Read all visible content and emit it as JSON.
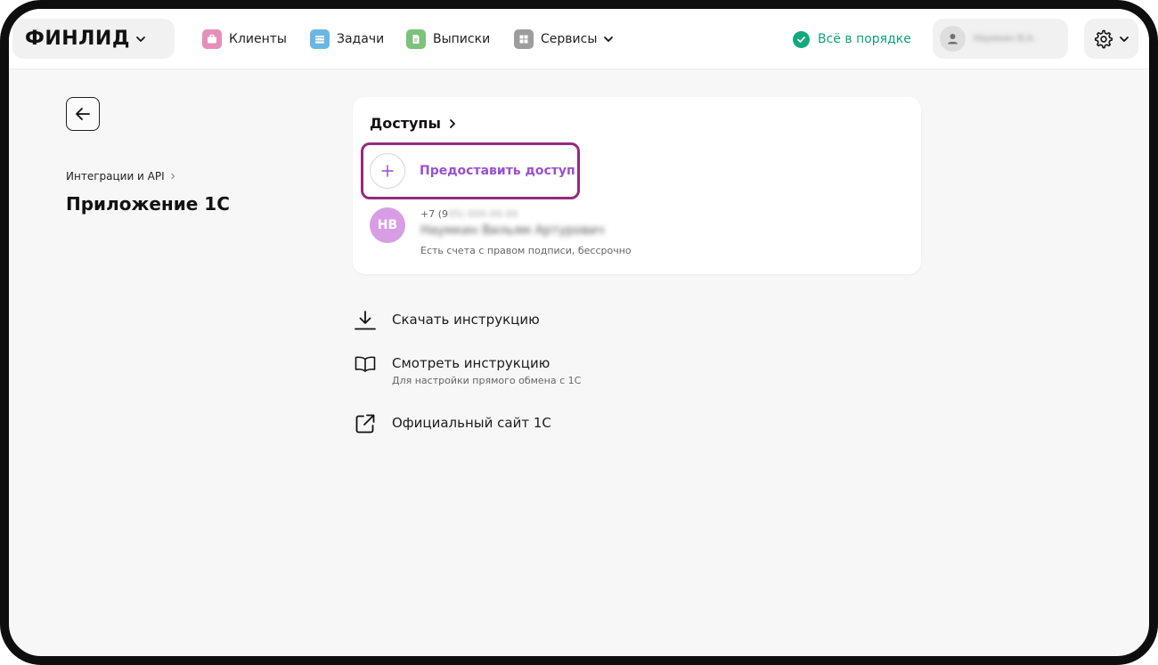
{
  "header": {
    "brand": "ФИНЛИД",
    "nav": [
      {
        "label": "Клиенты",
        "icon": "briefcase-icon",
        "color": "#e68fb8"
      },
      {
        "label": "Задачи",
        "icon": "stack-icon",
        "color": "#6ab7e3"
      },
      {
        "label": "Выписки",
        "icon": "document-icon",
        "color": "#7cc27a"
      },
      {
        "label": "Сервисы",
        "icon": "grid-icon",
        "color": "#9d9d9d"
      }
    ],
    "status": "Всё в порядке",
    "user_name": "Наумкин В.А."
  },
  "left": {
    "breadcrumb": "Интеграции и API",
    "title": "Приложение 1С"
  },
  "card": {
    "title": "Доступы",
    "grant_label": "Предоставить доступ",
    "access": {
      "initials": "НВ",
      "phone_prefix": "+7 (9",
      "phone_rest": "05) 000-00-00",
      "name": "Наумкин Вильям Артурович",
      "description": "Есть счета с правом подписи, бессрочно"
    }
  },
  "links": [
    {
      "label": "Скачать инструкцию",
      "icon": "download-icon",
      "subtitle": ""
    },
    {
      "label": "Смотреть инструкцию",
      "icon": "book-icon",
      "subtitle": "Для настройки прямого обмена с 1С"
    },
    {
      "label": "Официальный сайт 1С",
      "icon": "external-link-icon",
      "subtitle": ""
    }
  ],
  "colors": {
    "accent": "#9a4fd0",
    "highlight_border": "#942b7e",
    "success": "#0fa37a",
    "avatar": "#d99de5"
  }
}
